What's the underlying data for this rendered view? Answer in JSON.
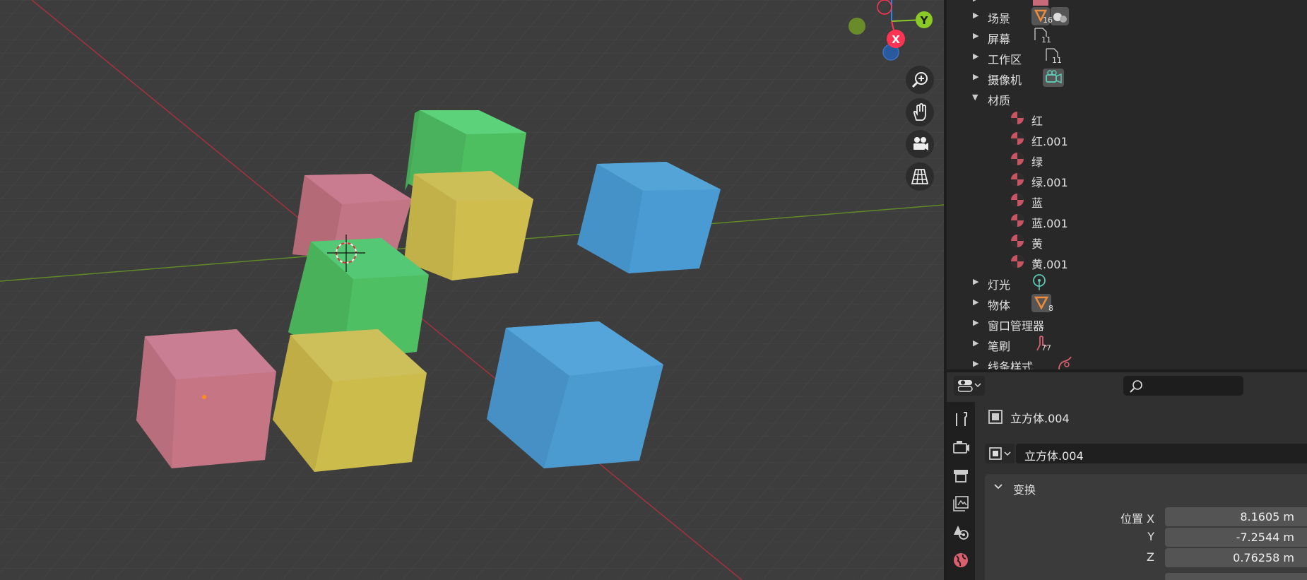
{
  "viewport": {
    "gizmo": {
      "x_label": "X",
      "y_label": "Y"
    },
    "nav_buttons": [
      "zoom-icon",
      "pan-hand-icon",
      "camera-icon",
      "perspective-grid-icon"
    ]
  },
  "outliner": {
    "items": [
      {
        "label": "场景",
        "count": "16",
        "expanded": false
      },
      {
        "label": "屏幕",
        "count": "11",
        "expanded": false
      },
      {
        "label": "工作区",
        "count": "11",
        "expanded": false
      },
      {
        "label": "摄像机",
        "count": "",
        "expanded": false
      },
      {
        "label": "材质",
        "count": "",
        "expanded": true
      },
      {
        "label": "灯光",
        "count": "",
        "expanded": false
      },
      {
        "label": "物体",
        "count": "8",
        "expanded": false
      },
      {
        "label": "窗口管理器",
        "count": "",
        "expanded": false
      },
      {
        "label": "笔刷",
        "count": "77",
        "expanded": false
      },
      {
        "label": "线条样式",
        "count": "",
        "expanded": false
      }
    ],
    "materials": [
      "红",
      "红.001",
      "绿",
      "绿.001",
      "蓝",
      "蓝.001",
      "黄",
      "黄.001"
    ]
  },
  "properties": {
    "object_name": "立方体.004",
    "data_name": "立方体.004",
    "panel_title": "变换",
    "location": {
      "label_x": "位置 X",
      "label_y": "Y",
      "label_z": "Z",
      "x": "8.1605 m",
      "y": "-7.2544 m",
      "z": "0.76258 m"
    }
  },
  "colors": {
    "pink": "#c77585",
    "green": "#52c26a",
    "yellow": "#cdbd4e",
    "blue": "#4d9bd0",
    "axis_x": "#ff3352",
    "axis_y": "#8bc926",
    "axis_z": "#2f83e3"
  }
}
